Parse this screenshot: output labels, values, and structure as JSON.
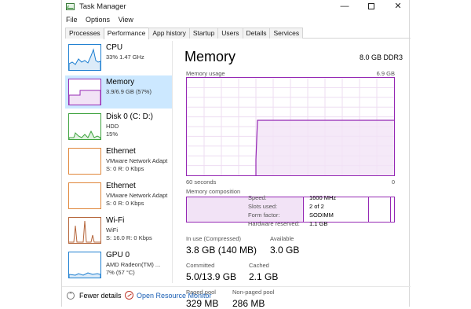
{
  "window": {
    "title": "Task Manager"
  },
  "controls": {
    "minimize": "—",
    "close": "✕"
  },
  "menu": [
    "File",
    "Options",
    "View"
  ],
  "tabs": [
    "Processes",
    "Performance",
    "App history",
    "Startup",
    "Users",
    "Details",
    "Services"
  ],
  "active_tab": "Performance",
  "sidebar": [
    {
      "name": "CPU",
      "sub1": "33% 1.47 GHz",
      "sub2": "",
      "color": "#1e7fd1",
      "selected": false
    },
    {
      "name": "Memory",
      "sub1": "3.9/6.9 GB (57%)",
      "sub2": "",
      "color": "#9528b4",
      "selected": true
    },
    {
      "name": "Disk 0 (C: D:)",
      "sub1": "HDD",
      "sub2": "15%",
      "color": "#3ea33e",
      "selected": false
    },
    {
      "name": "Ethernet",
      "sub1": "VMware Network Adapt",
      "sub2": "S: 0 R: 0 Kbps",
      "color": "#e0863a",
      "selected": false
    },
    {
      "name": "Ethernet",
      "sub1": "VMware Network Adapt",
      "sub2": "S: 0 R: 0 Kbps",
      "color": "#e0863a",
      "selected": false
    },
    {
      "name": "Wi-Fi",
      "sub1": "WiFi",
      "sub2": "S: 16.0 R: 0 Kbps",
      "color": "#b5653a",
      "selected": false
    },
    {
      "name": "GPU 0",
      "sub1": "AMD Radeon(TM) ...",
      "sub2": "7% (57 °C)",
      "color": "#1e7fd1",
      "selected": false
    }
  ],
  "main": {
    "title": "Memory",
    "spec": "8.0 GB DDR3",
    "usage_label": "Memory usage",
    "usage_max": "6.9 GB",
    "axis_left": "60 seconds",
    "axis_right": "0",
    "composition_label": "Memory composition",
    "in_use_fraction": 0.57
  },
  "stats": {
    "in_use_label": "In use (Compressed)",
    "in_use_value": "3.8 GB (140 MB)",
    "available_label": "Available",
    "available_value": "3.0 GB",
    "committed_label": "Committed",
    "committed_value": "5.0/13.9 GB",
    "cached_label": "Cached",
    "cached_value": "2.1 GB",
    "paged_label": "Paged pool",
    "paged_value": "329 MB",
    "nonpaged_label": "Non-paged pool",
    "nonpaged_value": "286 MB"
  },
  "specs": [
    {
      "k": "Speed:",
      "v": "1600 MHz"
    },
    {
      "k": "Slots used:",
      "v": "2 of 2"
    },
    {
      "k": "Form factor:",
      "v": "SODIMM"
    },
    {
      "k": "Hardware reserved:",
      "v": "1.1 GB"
    }
  ],
  "footer": {
    "fewer_details": "Fewer details",
    "open_monitor": "Open Resource Monitor"
  },
  "colors": {
    "memory": "#9528b4",
    "selection": "#cce8ff",
    "link": "#1a5fb4"
  }
}
